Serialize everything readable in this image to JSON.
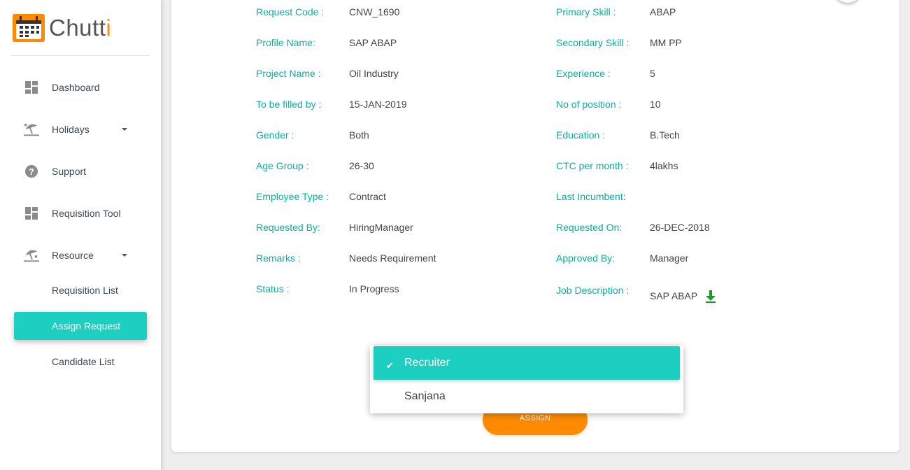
{
  "app": {
    "logo_text_main": "Chutt",
    "logo_text_accent": "i",
    "accent_color": "#1ccfc0",
    "brand_orange": "#ff8a00"
  },
  "sidebar": {
    "items": [
      {
        "label": "Dashboard",
        "icon": "dashboard-icon"
      },
      {
        "label": "Holidays",
        "icon": "beach-icon"
      },
      {
        "label": "Support",
        "icon": "help-icon"
      },
      {
        "label": "Requisition Tool",
        "icon": "dashboard-icon"
      },
      {
        "label": "Resource",
        "icon": "beach-icon"
      }
    ],
    "sub_items": [
      {
        "label": "Requisition List"
      },
      {
        "label": "Assign Request",
        "active": true
      },
      {
        "label": "Candidate List"
      }
    ]
  },
  "details": {
    "left": [
      {
        "label": "Request Code :",
        "value": "CNW_1690"
      },
      {
        "label": "Profile Name:",
        "value": "SAP ABAP"
      },
      {
        "label": "Project Name :",
        "value": "Oil Industry"
      },
      {
        "label": "To be filled by :",
        "value": "15-JAN-2019"
      },
      {
        "label": "Gender :",
        "value": "Both"
      },
      {
        "label": "Age Group :",
        "value": "26-30"
      },
      {
        "label": "Employee Type :",
        "value": "Contract"
      },
      {
        "label": "Requested By:",
        "value": "HiringManager"
      },
      {
        "label": "Remarks :",
        "value": "Needs Requirement"
      },
      {
        "label": "Status :",
        "value": "In Progress"
      }
    ],
    "right": [
      {
        "label": "Primary Skill :",
        "value": "ABAP"
      },
      {
        "label": "Secondary Skill :",
        "value": "MM PP"
      },
      {
        "label": "Experience :",
        "value": "5"
      },
      {
        "label": "No of position :",
        "value": "10"
      },
      {
        "label": "Education :",
        "value": "B.Tech"
      },
      {
        "label": "CTC per month :",
        "value": "4lakhs"
      },
      {
        "label": "Last Incumbent:",
        "value": ""
      },
      {
        "label": "Requested On:",
        "value": "26-DEC-2018"
      },
      {
        "label": "Approved By:",
        "value": "Manager"
      }
    ],
    "job_description": {
      "label": "Job Description :",
      "value": "SAP ABAP",
      "icon": "download-icon"
    }
  },
  "dropdown": {
    "options": [
      {
        "label": "Recruiter",
        "selected": true
      },
      {
        "label": "Sanjana",
        "selected": false
      }
    ]
  },
  "actions": {
    "assign_label": "ASSIGN"
  }
}
